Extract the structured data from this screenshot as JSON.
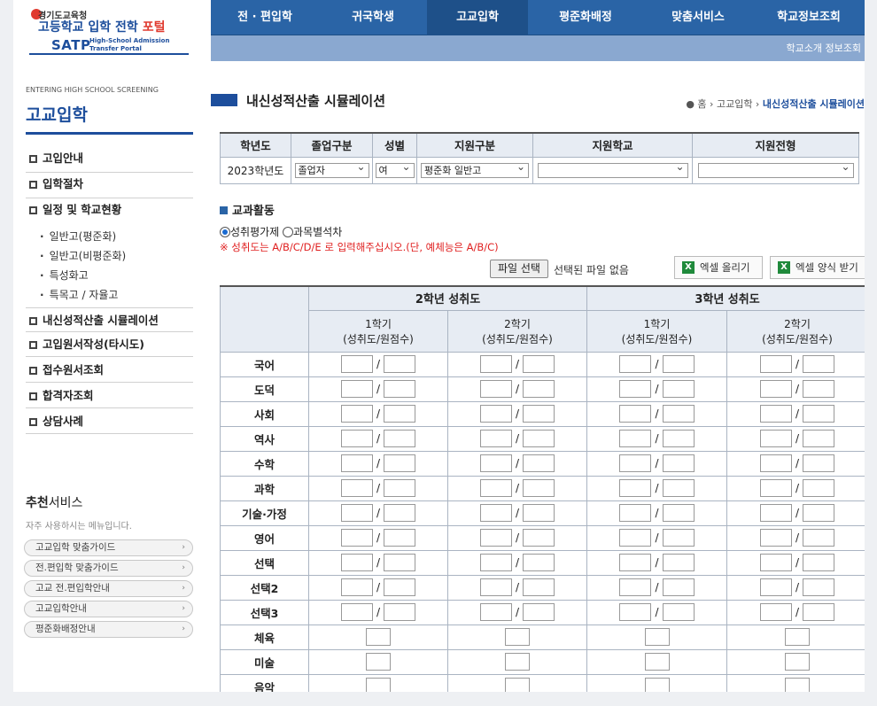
{
  "logo": {
    "line1": "경기도교육청",
    "line2a": "고등학교 ",
    "line2b": "입학 전학 ",
    "line2c": "포털",
    "satp": "SATP",
    "satp_sub1": "High-School Admission",
    "satp_sub2": "Transfer Portal"
  },
  "topnav": [
    "전 · 편입학",
    "귀국학생",
    "고교입학",
    "평준화배정",
    "맞춤서비스",
    "학교정보조회"
  ],
  "subnav": "학교소개 정보조회",
  "side": {
    "eng": "ENTERING HIGH SCHOOL SCREENING",
    "title": "고교입학",
    "menu": [
      "고입안내",
      "입학절차",
      "일정 및 학교현황"
    ],
    "sub": [
      "일반고(평준화)",
      "일반고(비평준화)",
      "특성화고",
      "특목고 / 자율고"
    ],
    "menu2": [
      "내신성적산출 시뮬레이션",
      "고입원서작성(타시도)",
      "접수원서조회",
      "합격자조회",
      "상담사례"
    ],
    "rec_title_a": "추천",
    "rec_title_b": "서비스",
    "rec_sub": "자주 사용하시는 메뉴입니다.",
    "rec_items": [
      "고교입학 맞춤가이드",
      "전.편입학 맞춤가이드",
      "고교 전.편입학안내",
      "고교입학안내",
      "평준화배정안내"
    ]
  },
  "page": {
    "title": "내신성적산출 시뮬레이션",
    "breadcrumb_home": "홈",
    "breadcrumb_mid": "고교입학",
    "breadcrumb_cur": "내신성적산출 시뮬레이션"
  },
  "form": {
    "headers": [
      "학년도",
      "졸업구분",
      "성별",
      "지원구분",
      "지원학교",
      "지원전형"
    ],
    "year": "2023학년도",
    "grad": "졸업자",
    "gender": "여",
    "apply_type": "평준화 일반고",
    "school": "",
    "track": ""
  },
  "section_title": "교과활동",
  "radio1": "성취평가제",
  "radio2": "과목별석차",
  "notice": "※ 성취도는 A/B/C/D/E 로 입력해주십시오.(단, 예체능은 A/B/C)",
  "file_btn": "파일 선택",
  "file_txt": "선택된 파일 없음",
  "excel_up": "엑셀 올리기",
  "excel_form": "엑셀 양식 받기",
  "grades": {
    "g2": "2학년 성취도",
    "g3": "3학년 성취도",
    "sem1": "1학기",
    "sem2": "2학기",
    "unit": "(성취도/원점수)"
  },
  "subjects": [
    "국어",
    "도덕",
    "사회",
    "역사",
    "수학",
    "과학",
    "기술·가정",
    "영어",
    "선택",
    "선택2",
    "선택3"
  ],
  "arts": [
    "체육",
    "미술",
    "음악"
  ]
}
